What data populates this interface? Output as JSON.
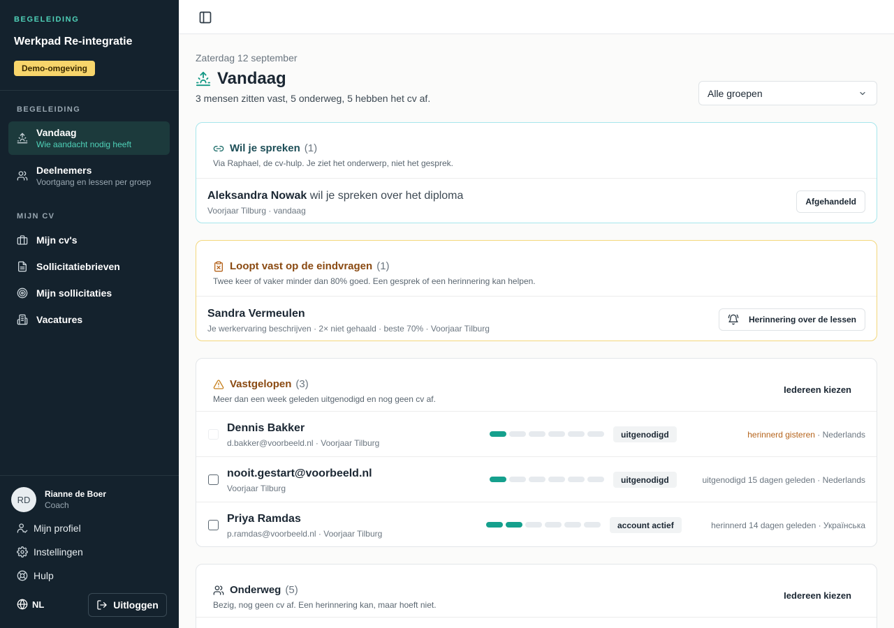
{
  "sidebar": {
    "eyebrow": "BEGELEIDING",
    "app_title": "Werkpad Re-integratie",
    "env_badge": "Demo-omgeving",
    "section1_label": "BEGELEIDING",
    "nav1": [
      {
        "label": "Vandaag",
        "sub": "Wie aandacht nodig heeft",
        "icon": "sunrise-icon",
        "active": true
      },
      {
        "label": "Deelnemers",
        "sub": "Voortgang en lessen per groep",
        "icon": "users-icon",
        "active": false
      }
    ],
    "section2_label": "MIJN CV",
    "nav2": [
      {
        "label": "Mijn cv's",
        "icon": "briefcase-icon"
      },
      {
        "label": "Sollicitatiebrieven",
        "icon": "document-icon"
      },
      {
        "label": "Mijn sollicitaties",
        "icon": "target-icon"
      },
      {
        "label": "Vacatures",
        "icon": "building-icon"
      }
    ],
    "user": {
      "initials": "RD",
      "name": "Rianne de Boer",
      "role": "Coach"
    },
    "util": [
      {
        "label": "Mijn profiel",
        "icon": "user-icon"
      },
      {
        "label": "Instellingen",
        "icon": "gear-icon"
      },
      {
        "label": "Hulp",
        "icon": "lifebuoy-icon"
      }
    ],
    "language": "NL",
    "logout_label": "Uitloggen"
  },
  "header": {
    "date": "Zaterdag 12 september",
    "title": "Vandaag",
    "summary": "3 mensen zitten vast, 5 onderweg, 5 hebben het cv af.",
    "group_filter": "Alle groepen"
  },
  "cards": {
    "speak": {
      "title": "Wil je spreken",
      "count": "(1)",
      "desc": "Via Raphael, de cv-hulp. Je ziet het onderwerp, niet het gesprek.",
      "row": {
        "name": "Aleksandra Nowak",
        "rest": " wil je spreken over het diploma",
        "meta": "Voorjaar Tilburg · vandaag",
        "action": "Afgehandeld"
      }
    },
    "stuck_questions": {
      "title": "Loopt vast op de eindvragen",
      "count": "(1)",
      "desc": "Twee keer of vaker minder dan 80% goed. Een gesprek of een herinnering kan helpen.",
      "row": {
        "name": "Sandra Vermeulen",
        "meta": "Je werkervaring beschrijven · 2× niet gehaald · beste 70% · Voorjaar Tilburg",
        "action": "Herinnering over de lessen"
      }
    },
    "stuck": {
      "title": "Vastgelopen",
      "count": "(3)",
      "desc": "Meer dan een week geleden uitgenodigd en nog geen cv af.",
      "choose_all": "Iedereen kiezen",
      "rows": [
        {
          "name": "Dennis Bakker",
          "meta": "d.bakker@voorbeeld.nl · Voorjaar Tilburg",
          "progress": 1,
          "tag": "uitgenodigd",
          "status_warn": "herinnerd gisteren",
          "status_rest": " · Nederlands",
          "checkbox_disabled": true
        },
        {
          "name": "nooit.gestart@voorbeeld.nl",
          "meta": "Voorjaar Tilburg",
          "progress": 1,
          "tag": "uitgenodigd",
          "status_warn": "",
          "status_rest": "uitgenodigd 15 dagen geleden · Nederlands",
          "checkbox_disabled": false
        },
        {
          "name": "Priya Ramdas",
          "meta": "p.ramdas@voorbeeld.nl · Voorjaar Tilburg",
          "progress": 2,
          "tag": "account actief",
          "status_warn": "",
          "status_rest": "herinnerd 14 dagen geleden · Українська",
          "checkbox_disabled": false
        }
      ]
    },
    "underway": {
      "title": "Onderweg",
      "count": "(5)",
      "desc": "Bezig, nog geen cv af. Een herinnering kan, maar hoeft niet.",
      "choose_all": "Iedereen kiezen"
    }
  },
  "colors": {
    "teal": "#129884",
    "amber_text": "#8a4a12",
    "sidebar_bg": "#14222d",
    "badge": "#f7d56b"
  }
}
